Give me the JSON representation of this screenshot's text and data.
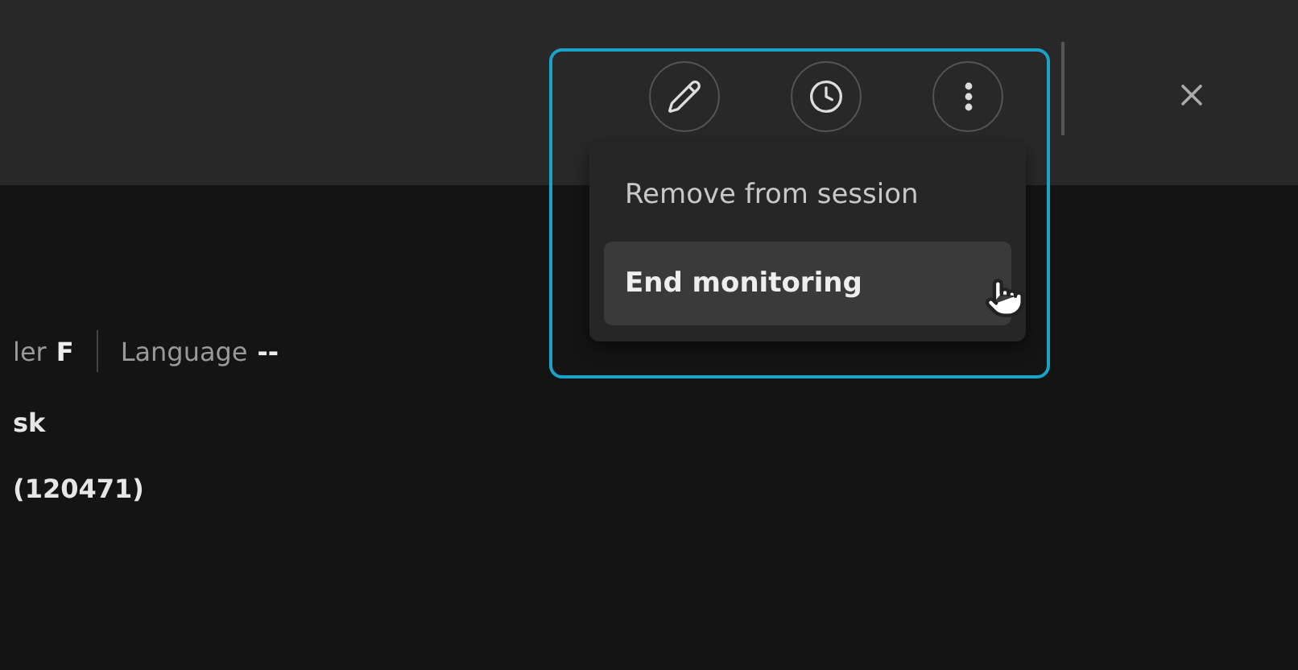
{
  "toolbar": {
    "buttons": [
      {
        "kind": "edit"
      },
      {
        "kind": "history"
      },
      {
        "kind": "more"
      }
    ]
  },
  "menu": {
    "items": [
      {
        "label": "Remove from session",
        "selected": false
      },
      {
        "label": "End monitoring",
        "selected": true
      }
    ]
  },
  "details": {
    "fields": [
      {
        "label": "ler",
        "value": "F"
      },
      {
        "label": "Language",
        "value": "--"
      }
    ],
    "lines": [
      "sk",
      "(120471)"
    ]
  }
}
